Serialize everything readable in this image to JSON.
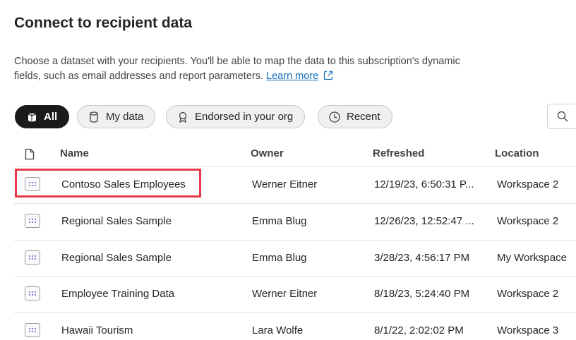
{
  "dialog": {
    "title": "Connect to recipient data",
    "description": "Choose a dataset with your recipients. You'll be able to map the data to this subscription's dynamic fields, such as email addresses and report parameters.",
    "learn_more": "Learn more"
  },
  "filters": [
    {
      "label": "All",
      "icon": "all-items-icon",
      "active": true
    },
    {
      "label": "My data",
      "icon": "database-icon",
      "active": false
    },
    {
      "label": "Endorsed in your org",
      "icon": "ribbon-icon",
      "active": false
    },
    {
      "label": "Recent",
      "icon": "clock-icon",
      "active": false
    }
  ],
  "search": {
    "icon": "search-icon"
  },
  "table": {
    "headers": {
      "type_icon": "file-icon",
      "name": "Name",
      "owner": "Owner",
      "refreshed": "Refreshed",
      "location": "Location"
    },
    "rows": [
      {
        "name": "Contoso Sales Employees",
        "owner": "Werner Eitner",
        "refreshed": "12/19/23, 6:50:31 P...",
        "location": "Workspace 2",
        "highlighted": true
      },
      {
        "name": "Regional Sales Sample",
        "owner": "Emma Blug",
        "refreshed": "12/26/23, 12:52:47 ...",
        "location": "Workspace 2",
        "highlighted": false
      },
      {
        "name": "Regional Sales Sample",
        "owner": "Emma Blug",
        "refreshed": "3/28/23, 4:56:17 PM",
        "location": "My Workspace",
        "highlighted": false
      },
      {
        "name": "Employee Training Data",
        "owner": "Werner Eitner",
        "refreshed": "8/18/23, 5:24:40 PM",
        "location": "Workspace 2",
        "highlighted": false
      },
      {
        "name": "Hawaii Tourism",
        "owner": "Lara Wolfe",
        "refreshed": "8/1/22, 2:02:02 PM",
        "location": "Workspace 3",
        "highlighted": false
      }
    ]
  },
  "colors": {
    "link": "#0f6cbd",
    "highlight": "#e8394a",
    "active_pill": "#1b1b1b"
  }
}
